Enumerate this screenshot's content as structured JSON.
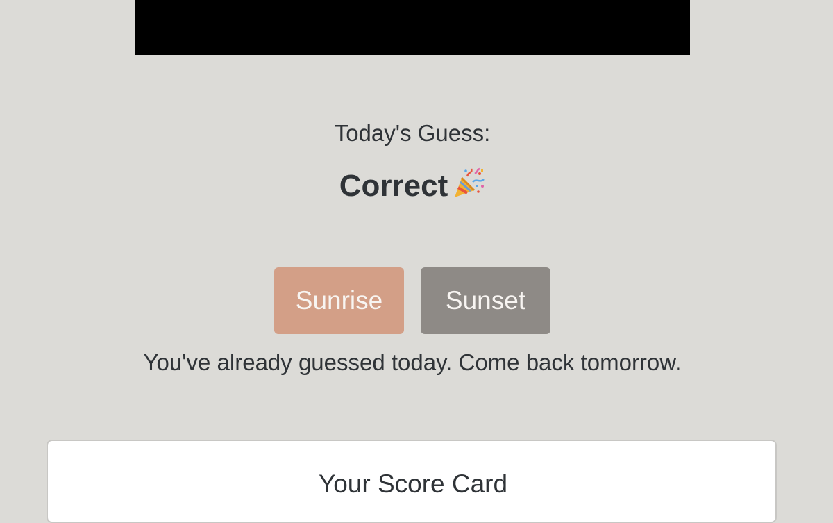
{
  "guess": {
    "label": "Today's Guess:",
    "result": "Correct",
    "result_icon": "party-popper-icon"
  },
  "buttons": {
    "sunrise_label": "Sunrise",
    "sunset_label": "Sunset"
  },
  "status": {
    "message": "You've already guessed today. Come back tomorrow."
  },
  "score_card": {
    "title": "Your Score Card"
  },
  "colors": {
    "background": "#dcdbd7",
    "sunrise_button": "#d39f87",
    "sunset_button": "#8e8a86",
    "text": "#2f3337"
  }
}
